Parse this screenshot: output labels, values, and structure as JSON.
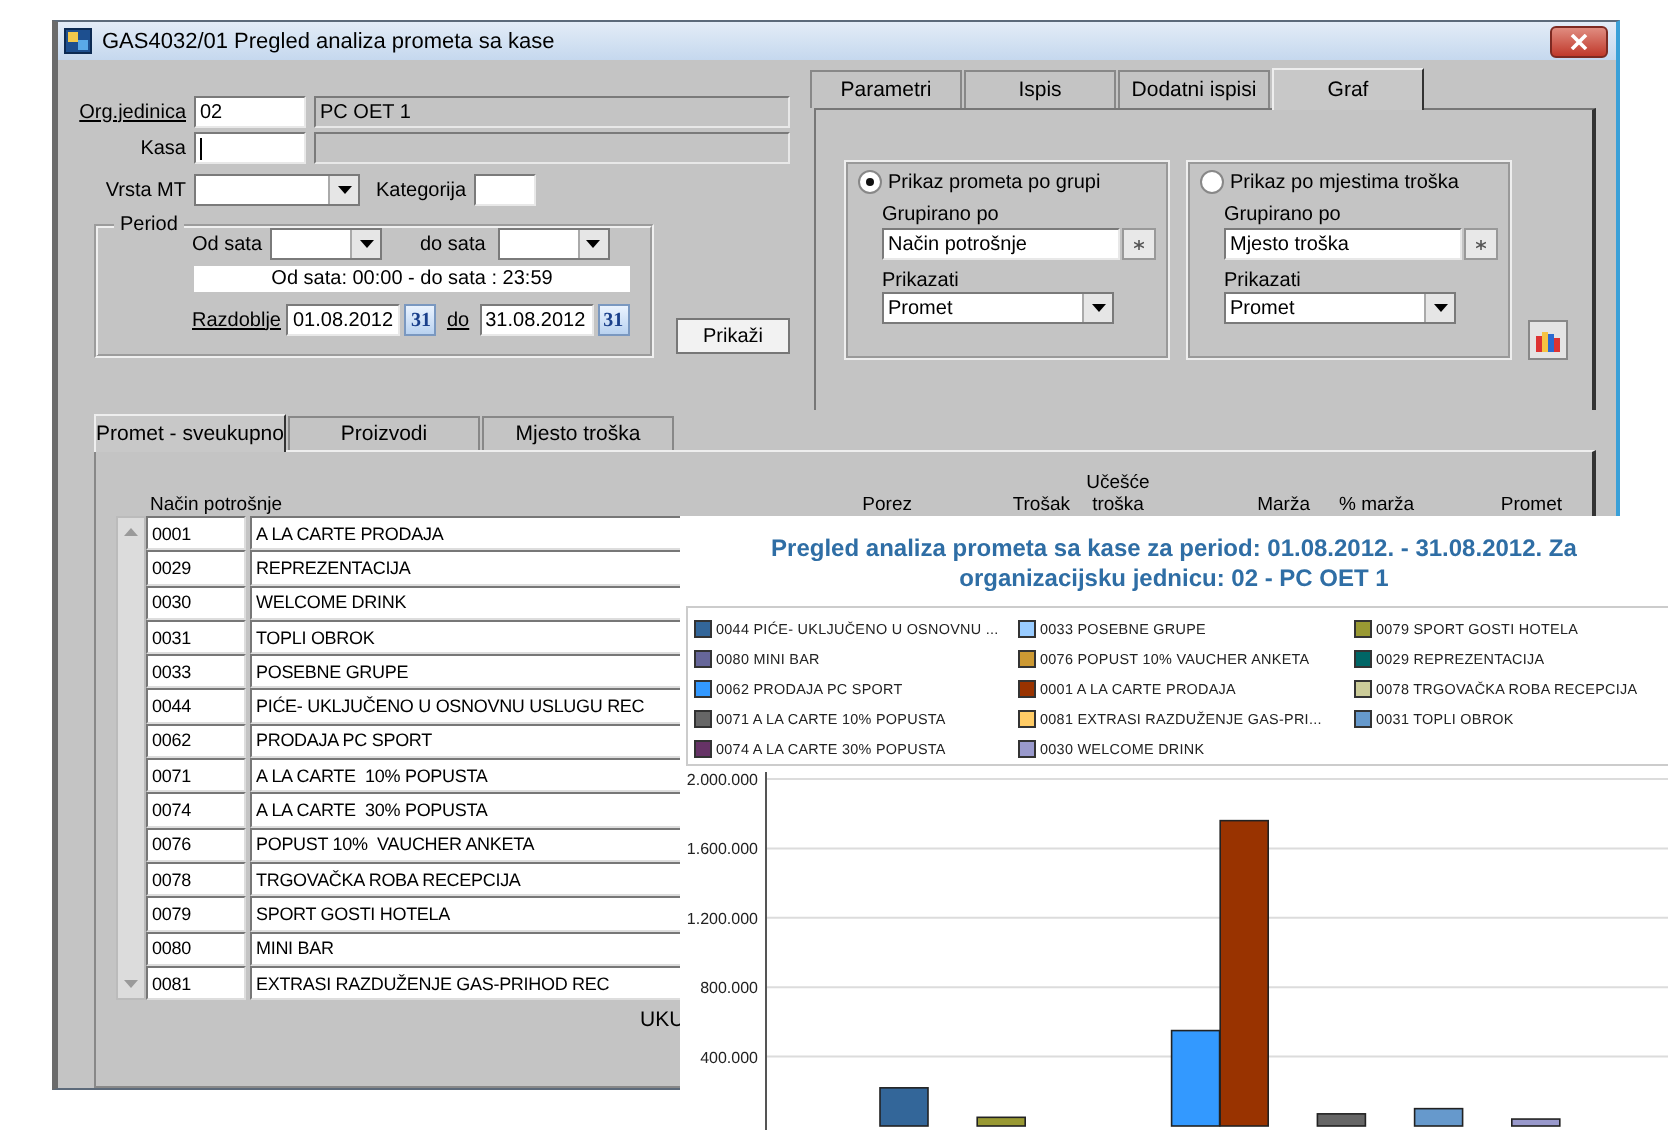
{
  "window": {
    "title": "GAS4032/01 Pregled analiza prometa sa kase"
  },
  "filters": {
    "org_label": "Org.jedinica",
    "org_code": "02",
    "org_name": "PC OET 1",
    "kasa_label": "Kasa",
    "vrsta_label": "Vrsta MT",
    "kategorija_label": "Kategorija"
  },
  "period": {
    "legend": "Period",
    "from_hour_label": "Od sata",
    "to_hour_label": "do sata",
    "info": "Od sata: 00:00 - do sata : 23:59",
    "range_label": "Razdoblje",
    "date_from": "01.08.2012",
    "calendar_from": "31",
    "to_label": "do",
    "date_to": "31.08.2012",
    "calendar_to": "31"
  },
  "show_button": "Prikaži",
  "option_tabs": [
    {
      "label": "Parametri",
      "selected": false
    },
    {
      "label": "Ispis",
      "selected": false
    },
    {
      "label": "Dodatni ispisi",
      "selected": false
    },
    {
      "label": "Graf",
      "selected": true
    }
  ],
  "graph_options": [
    {
      "label": "Prikaz prometa po grupi",
      "selected": true,
      "group_label": "Grupirano po",
      "group_value": "Način potrošnje",
      "show_label": "Prikazati",
      "show_value": "Promet"
    },
    {
      "label": "Prikaz po mjestima troška",
      "selected": false,
      "group_label": "Grupirano po",
      "group_value": "Mjesto troška",
      "show_label": "Prikazati",
      "show_value": "Promet"
    }
  ],
  "result_tabs": [
    {
      "label": "Promet - sveukupno",
      "selected": true
    },
    {
      "label": "Proizvodi",
      "selected": false
    },
    {
      "label": "Mjesto troška",
      "selected": false
    }
  ],
  "table": {
    "columns": [
      "Način potrošnje",
      "Porez",
      "Trošak",
      "Učešće troška",
      "Marža",
      "% marža",
      "Promet"
    ],
    "rows": [
      {
        "code": "0001",
        "name": "A LA CARTE PRODAJA"
      },
      {
        "code": "0029",
        "name": "REPREZENTACIJA"
      },
      {
        "code": "0030",
        "name": "WELCOME DRINK"
      },
      {
        "code": "0031",
        "name": "TOPLI OBROK"
      },
      {
        "code": "0033",
        "name": "POSEBNE GRUPE"
      },
      {
        "code": "0044",
        "name": "PIĆE- UKLJUČENO U OSNOVNU USLUGU REC"
      },
      {
        "code": "0062",
        "name": "PRODAJA PC SPORT"
      },
      {
        "code": "0071",
        "name": "A LA CARTE  10% POPUSTA"
      },
      {
        "code": "0074",
        "name": "A LA CARTE  30% POPUSTA"
      },
      {
        "code": "0076",
        "name": "POPUST 10%  VAUCHER ANKETA"
      },
      {
        "code": "0078",
        "name": "TRGOVAČKA ROBA RECEPCIJA"
      },
      {
        "code": "0079",
        "name": "SPORT GOSTI HOTELA"
      },
      {
        "code": "0080",
        "name": "MINI BAR"
      },
      {
        "code": "0081",
        "name": "EXTRASI RAZDUŽENJE GAS-PRIHOD REC"
      }
    ],
    "total_label": "UKU"
  },
  "chart": {
    "chart_data": {
      "type": "bar",
      "grid": true,
      "title": "Pregled analiza prometa sa kase za period: 01.08.2012. - 31.08.2012. Za organizacijsku jednicu: 02 - PC OET 1",
      "ylim": [
        0,
        2000000
      ],
      "yticks": [
        {
          "value": 400000,
          "label": "400.000"
        },
        {
          "value": 800000,
          "label": "800.000"
        },
        {
          "value": 1200000,
          "label": "1.200.000"
        },
        {
          "value": 1600000,
          "label": "1.600.000"
        },
        {
          "value": 2000000,
          "label": "2.000.000"
        }
      ],
      "series": [
        {
          "name": "0044 PIĆE- UKLJUČENO U OSNOVNU ...",
          "color": "#336699",
          "values": [
            220000
          ]
        },
        {
          "name": "0033 POSEBNE GRUPE",
          "color": "#99ccff",
          "values": [
            0
          ]
        },
        {
          "name": "0079 SPORT GOSTI HOTELA",
          "color": "#999933",
          "values": [
            50000
          ]
        },
        {
          "name": "0080 MINI BAR",
          "color": "#666699",
          "values": [
            0
          ]
        },
        {
          "name": "0076 POPUST 10% VAUCHER ANKETA",
          "color": "#cc9933",
          "values": [
            0
          ]
        },
        {
          "name": "0029 REPREZENTACIJA",
          "color": "#006666",
          "values": [
            0
          ]
        },
        {
          "name": "0062 PRODAJA PC SPORT",
          "color": "#3399ff",
          "values": [
            550000
          ]
        },
        {
          "name": "0001 A LA CARTE PRODAJA",
          "color": "#993300",
          "values": [
            1760000
          ]
        },
        {
          "name": "0078 TRGOVAČKA ROBA RECEPCIJA",
          "color": "#cccc99",
          "values": [
            0
          ]
        },
        {
          "name": "0071 A LA CARTE 10% POPUSTA",
          "color": "#666666",
          "values": [
            70000
          ]
        },
        {
          "name": "0081 EXTRASI RAZDUŽENJE GAS-PRI...",
          "color": "#ffcc66",
          "values": [
            0
          ]
        },
        {
          "name": "0031 TOPLI OBROK",
          "color": "#6699cc",
          "values": [
            100000
          ]
        },
        {
          "name": "0074 A LA CARTE 30% POPUSTA",
          "color": "#663366",
          "values": [
            0
          ]
        },
        {
          "name": "0030 WELCOME DRINK",
          "color": "#9999cc",
          "values": [
            40000
          ]
        }
      ]
    }
  }
}
